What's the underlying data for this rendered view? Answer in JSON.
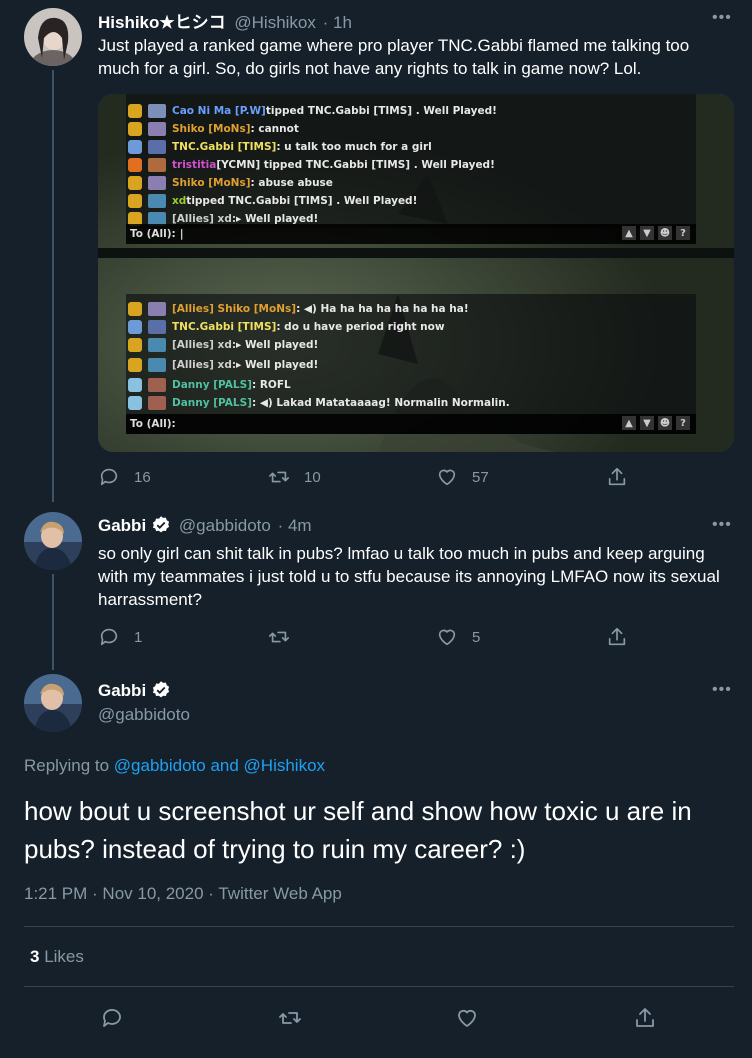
{
  "tweet1": {
    "name": "Hishiko★ヒシコ",
    "handle": "@Hishikox",
    "time": "· 1h",
    "text": "Just played a ranked game where pro player TNC.Gabbi flamed me talking too much for a girl. So, do girls not have any rights to talk in game now? Lol.",
    "replies": "16",
    "retweets": "10",
    "likes": "57"
  },
  "chat_top": {
    "lines": [
      [
        "Cao Ni Ma [P.W] ",
        "tipped TNC.Gabbi [TIMS] . Well Played!"
      ],
      [
        "Shiko [MoNs]",
        " : cannot"
      ],
      [
        "TNC.Gabbi [TIMS]",
        " : u talk too much for a girl"
      ],
      [
        "tristitia",
        " [YCMN]  tipped TNC.Gabbi [TIMS] . Well Played!"
      ],
      [
        "Shiko [MoNs]",
        " : abuse abuse"
      ],
      [
        "xd",
        " tipped TNC.Gabbi [TIMS] . Well Played!"
      ],
      [
        "[Allies] xd:",
        " ▸ Well played!"
      ]
    ],
    "to_all": "To (All):"
  },
  "chat_bottom": {
    "lines": [
      [
        "[Allies] Shiko [MoNs]",
        " : ◀) Ha ha ha ha ha ha ha ha!"
      ],
      [
        "TNC.Gabbi [TIMS]",
        " : do u have period right now"
      ],
      [
        "[Allies] xd:",
        " ▸ Well played!"
      ],
      [
        "[Allies] xd:",
        " ▸ Well played!"
      ],
      [
        "Danny [PALS]",
        " : ROFL"
      ],
      [
        "Danny [PALS]",
        " : ◀) Lakad Matataaaag! Normalin Normalin."
      ]
    ],
    "to_all": "To (All):"
  },
  "tweet2": {
    "name": "Gabbi",
    "handle": "@gabbidoto",
    "time": "· 4m",
    "text": "so only girl can shit talk in pubs? lmfao u talk too much in pubs and keep arguing with my teammates i just told u to stfu because its annoying LMFAO now its sexual harrassment?",
    "replies": "1",
    "likes": "5"
  },
  "tweet3": {
    "name": "Gabbi",
    "handle": "@gabbidoto",
    "replying_prefix": "Replying to",
    "replying_users": "@gabbidoto and @Hishikox",
    "text": "how bout u screenshot ur self and show how toxic u are in pubs? instead of trying to ruin my career? :)",
    "timestamp": "1:21 PM · Nov 10, 2020 · Twitter Web App",
    "like_count": "3",
    "like_label": "Likes"
  },
  "more_glyph": "•••",
  "colors": {
    "background": "#15202b",
    "muted": "#8899a6",
    "link": "#1da1f2",
    "divider": "#38444d"
  }
}
